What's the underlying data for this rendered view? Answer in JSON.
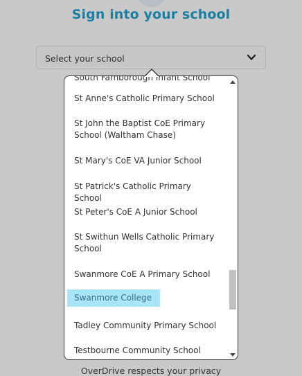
{
  "page": {
    "title": "Sign into your school",
    "footer": "OverDrive respects your privacy"
  },
  "select": {
    "label": "Select your school",
    "icon": "chevron-down-icon"
  },
  "dropdown": {
    "items": [
      {
        "label": "South Farnborough Infant School",
        "highlighted": false
      },
      {
        "label": "St Anne's Catholic Primary School",
        "highlighted": false
      },
      {
        "label": "St John the Baptist CoE Primary School (Waltham Chase)",
        "highlighted": false
      },
      {
        "label": "St Mary's CoE VA Junior School",
        "highlighted": false
      },
      {
        "label": "St Patrick's Catholic Primary School",
        "highlighted": false
      },
      {
        "label": "St Peter's CoE A Junior School",
        "highlighted": false
      },
      {
        "label": "St Swithun Wells Catholic Primary School",
        "highlighted": false
      },
      {
        "label": "Swanmore CoE A Primary School",
        "highlighted": false
      },
      {
        "label": "Swanmore College",
        "highlighted": true
      },
      {
        "label": "Tadley Community Primary School",
        "highlighted": false
      },
      {
        "label": "Testbourne Community School",
        "highlighted": false
      }
    ]
  },
  "colors": {
    "title": "#1a7fa1",
    "overlay": "#c9c9c9",
    "highlight": "#a6e6f8"
  }
}
